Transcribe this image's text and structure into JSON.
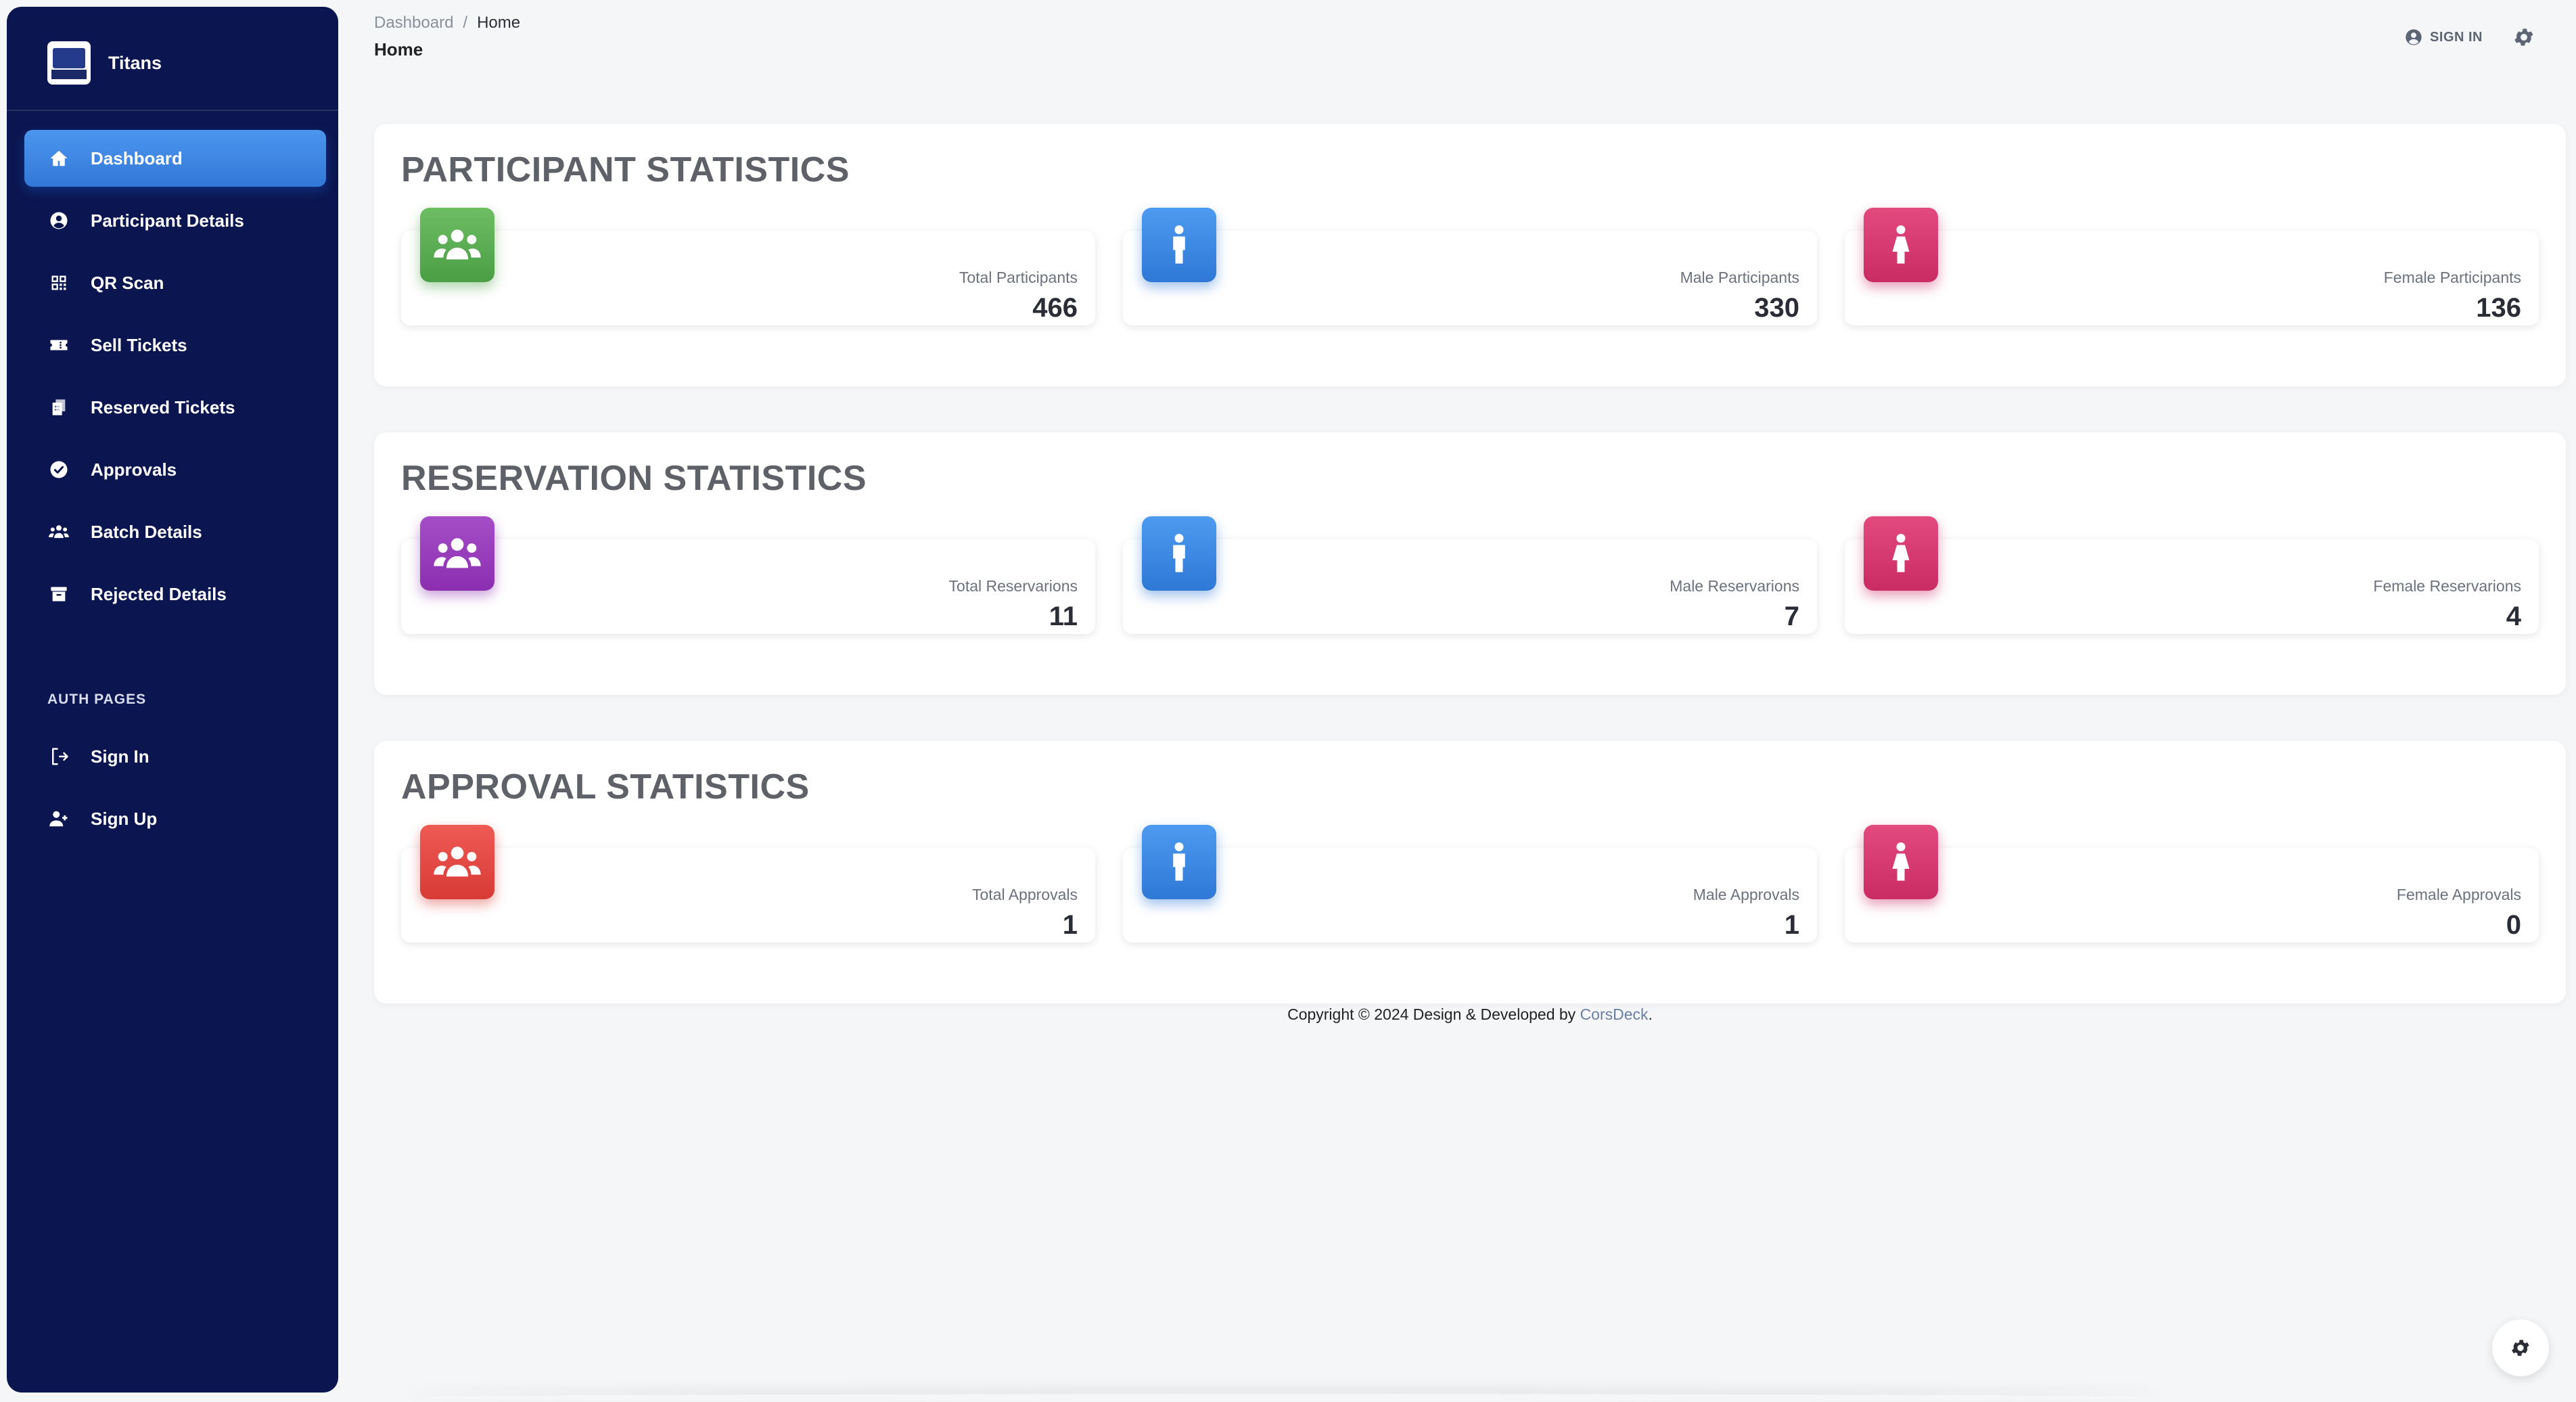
{
  "brand": {
    "name": "Titans"
  },
  "sidebar": {
    "items": [
      {
        "label": "Dashboard",
        "icon": "home-icon",
        "active": true
      },
      {
        "label": "Participant Details",
        "icon": "user-circle-icon"
      },
      {
        "label": "QR Scan",
        "icon": "qr-code-icon"
      },
      {
        "label": "Sell Tickets",
        "icon": "ticket-icon"
      },
      {
        "label": "Reserved Tickets",
        "icon": "reserved-tickets-icon"
      },
      {
        "label": "Approvals",
        "icon": "check-circle-icon"
      },
      {
        "label": "Batch Details",
        "icon": "group-icon"
      },
      {
        "label": "Rejected Details",
        "icon": "archive-icon"
      }
    ],
    "section_title": "AUTH PAGES",
    "auth_items": [
      {
        "label": "Sign In",
        "icon": "sign-in-icon"
      },
      {
        "label": "Sign Up",
        "icon": "user-add-icon"
      }
    ]
  },
  "breadcrumb": {
    "root": "Dashboard",
    "separator": "/",
    "current": "Home"
  },
  "page_title": "Home",
  "header": {
    "sign_in": "SIGN IN"
  },
  "sections": [
    {
      "title": "PARTICIPANT STATISTICS",
      "cards": [
        {
          "label": "Total Participants",
          "value": "466",
          "icon": "group-icon",
          "color": "#4b9e44"
        },
        {
          "label": "Male Participants",
          "value": "330",
          "icon": "male-icon",
          "color": "#2f78d6"
        },
        {
          "label": "Female Participants",
          "value": "136",
          "icon": "female-icon",
          "color": "#c92b63"
        }
      ]
    },
    {
      "title": "RESERVATION STATISTICS",
      "cards": [
        {
          "label": "Total Reservarions",
          "value": "11",
          "icon": "group-icon",
          "color": "#8b2fb0"
        },
        {
          "label": "Male Reservarions",
          "value": "7",
          "icon": "male-icon",
          "color": "#2f78d6"
        },
        {
          "label": "Female Reservarions",
          "value": "4",
          "icon": "female-icon",
          "color": "#c92b63"
        }
      ]
    },
    {
      "title": "APPROVAL STATISTICS",
      "cards": [
        {
          "label": "Total Approvals",
          "value": "1",
          "icon": "group-icon",
          "color": "#d83a35"
        },
        {
          "label": "Male Approvals",
          "value": "1",
          "icon": "male-icon",
          "color": "#2f78d6"
        },
        {
          "label": "Female Approvals",
          "value": "0",
          "icon": "female-icon",
          "color": "#c92b63"
        }
      ]
    }
  ],
  "footer": {
    "text": "Copyright © 2024 Design & Developed by",
    "link": "CorsDeck",
    "suffix": "."
  }
}
